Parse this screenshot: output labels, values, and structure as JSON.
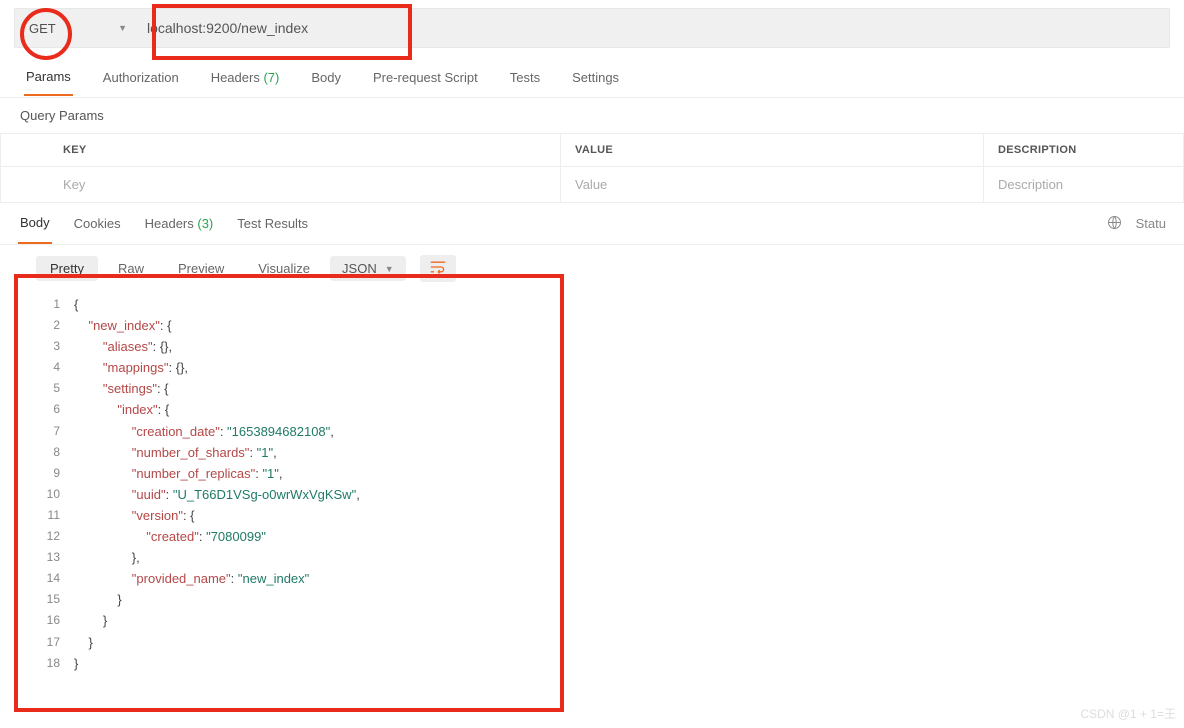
{
  "request": {
    "method": "GET",
    "url": "localhost:9200/new_index"
  },
  "reqTabs": {
    "items": [
      {
        "label": "Params",
        "active": true
      },
      {
        "label": "Authorization"
      },
      {
        "label": "Headers",
        "count": "(7)"
      },
      {
        "label": "Body"
      },
      {
        "label": "Pre-request Script"
      },
      {
        "label": "Tests"
      },
      {
        "label": "Settings"
      }
    ]
  },
  "querySection": {
    "title": "Query Params"
  },
  "paramsTable": {
    "headers": {
      "key": "KEY",
      "value": "VALUE",
      "desc": "DESCRIPTION"
    },
    "placeholders": {
      "key": "Key",
      "value": "Value",
      "desc": "Description"
    }
  },
  "respTabs": {
    "items": [
      {
        "label": "Body",
        "active": true
      },
      {
        "label": "Cookies"
      },
      {
        "label": "Headers",
        "count": "(3)"
      },
      {
        "label": "Test Results"
      }
    ],
    "status_prefix": "Statu"
  },
  "bodyToolbar": {
    "items": [
      {
        "label": "Pretty",
        "active": true
      },
      {
        "label": "Raw"
      },
      {
        "label": "Preview"
      },
      {
        "label": "Visualize"
      }
    ],
    "format": "JSON"
  },
  "code": [
    [
      [
        "p",
        "{"
      ]
    ],
    [
      [
        "p",
        "    "
      ],
      [
        "k",
        "\"new_index\""
      ],
      [
        "p",
        ": {"
      ]
    ],
    [
      [
        "p",
        "        "
      ],
      [
        "k",
        "\"aliases\""
      ],
      [
        "p",
        ": {},"
      ]
    ],
    [
      [
        "p",
        "        "
      ],
      [
        "k",
        "\"mappings\""
      ],
      [
        "p",
        ": {},"
      ]
    ],
    [
      [
        "p",
        "        "
      ],
      [
        "k",
        "\"settings\""
      ],
      [
        "p",
        ": {"
      ]
    ],
    [
      [
        "p",
        "            "
      ],
      [
        "k",
        "\"index\""
      ],
      [
        "p",
        ": {"
      ]
    ],
    [
      [
        "p",
        "                "
      ],
      [
        "k",
        "\"creation_date\""
      ],
      [
        "p",
        ": "
      ],
      [
        "s",
        "\"1653894682108\""
      ],
      [
        "p",
        ","
      ]
    ],
    [
      [
        "p",
        "                "
      ],
      [
        "k",
        "\"number_of_shards\""
      ],
      [
        "p",
        ": "
      ],
      [
        "s",
        "\"1\""
      ],
      [
        "p",
        ","
      ]
    ],
    [
      [
        "p",
        "                "
      ],
      [
        "k",
        "\"number_of_replicas\""
      ],
      [
        "p",
        ": "
      ],
      [
        "s",
        "\"1\""
      ],
      [
        "p",
        ","
      ]
    ],
    [
      [
        "p",
        "                "
      ],
      [
        "k",
        "\"uuid\""
      ],
      [
        "p",
        ": "
      ],
      [
        "s",
        "\"U_T66D1VSg-o0wrWxVgKSw\""
      ],
      [
        "p",
        ","
      ]
    ],
    [
      [
        "p",
        "                "
      ],
      [
        "k",
        "\"version\""
      ],
      [
        "p",
        ": {"
      ]
    ],
    [
      [
        "p",
        "                    "
      ],
      [
        "k",
        "\"created\""
      ],
      [
        "p",
        ": "
      ],
      [
        "s",
        "\"7080099\""
      ]
    ],
    [
      [
        "p",
        "                },"
      ]
    ],
    [
      [
        "p",
        "                "
      ],
      [
        "k",
        "\"provided_name\""
      ],
      [
        "p",
        ": "
      ],
      [
        "s",
        "\"new_index\""
      ]
    ],
    [
      [
        "p",
        "            }"
      ]
    ],
    [
      [
        "p",
        "        }"
      ]
    ],
    [
      [
        "p",
        "    }"
      ]
    ],
    [
      [
        "p",
        "}"
      ]
    ]
  ],
  "watermark": "CSDN @1 + 1=王"
}
